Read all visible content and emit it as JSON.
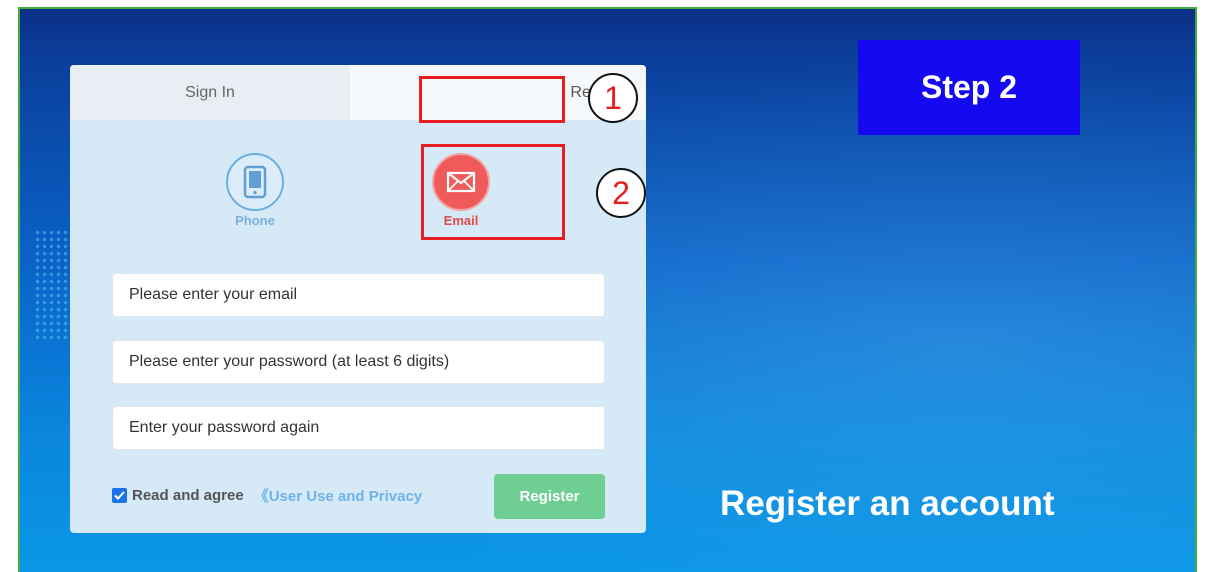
{
  "tabs": {
    "sign_in": "Sign In",
    "register": "Register"
  },
  "methods": {
    "phone": {
      "label": "Phone",
      "icon": "phone-icon"
    },
    "email": {
      "label": "Email",
      "icon": "envelope-icon"
    }
  },
  "fields": {
    "email_placeholder": "Please enter your email",
    "password_placeholder": "Please enter your password (at least 6 digits)",
    "confirm_placeholder": "Enter your password again"
  },
  "agree": {
    "checked": true,
    "text": "Read and agree",
    "policy_link": "《User Use and Privacy"
  },
  "register_button": "Register",
  "annotations": {
    "marker_1": "1",
    "marker_2": "2"
  },
  "step_label": "Step 2",
  "caption": "Register an account",
  "colors": {
    "highlight": "#e81e1e",
    "step_bg": "#1409f0",
    "register_button": "#6fcf93",
    "email_accent": "#ef5b5b",
    "phone_accent": "#6aaee4"
  }
}
